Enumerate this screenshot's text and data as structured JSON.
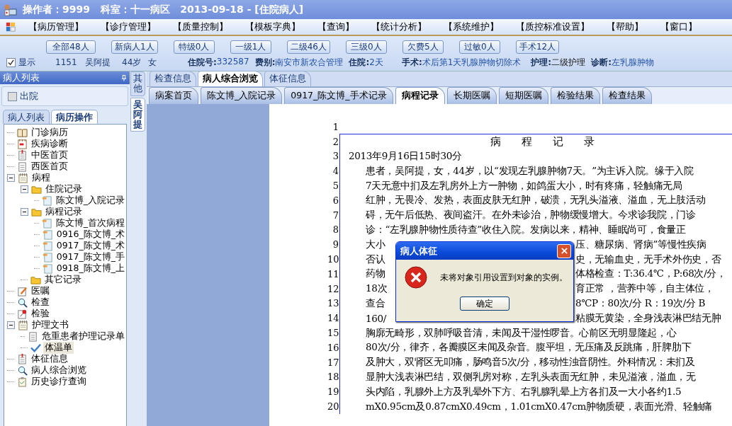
{
  "title_bar": {
    "text": "操作者：9999   科室：十一病区   2013-09-18 - [住院病人]"
  },
  "menu": [
    "【病历管理】",
    "【诊疗管理】",
    "【质量控制】",
    "【模板字典】",
    "【查询】",
    "【统计分析】",
    "【系统维护】",
    "【质控标准设置】",
    "【帮助】",
    "【窗口】"
  ],
  "filters": [
    "全部48人",
    "新病人1人",
    "特级0人",
    "一级1人",
    "二级46人",
    "三级0人",
    "欠费5人",
    "过敏0人",
    "手术12人"
  ],
  "patient": {
    "show": {
      "label": "显示",
      "checked": true
    },
    "bed": "1151",
    "name": "吴阿提",
    "age": "44岁",
    "sex": "女",
    "fields": [
      {
        "label": "住院号:",
        "value": "332587"
      },
      {
        "label": "费别:",
        "value": "南安市新农合管理"
      },
      {
        "label": "住院:",
        "value": "2天"
      },
      {
        "label": "手术:",
        "value": "术后第1天乳腺肿物切除术"
      },
      {
        "label": "护理:",
        "value": "二级护理"
      },
      {
        "label": "诊断:",
        "value": "左乳腺肿物"
      }
    ]
  },
  "left_panel": {
    "title": "病人列表",
    "discharged": {
      "label": "出院",
      "checked": false
    },
    "tabs": [
      {
        "label": "病人列表",
        "selected": false
      },
      {
        "label": "病历操作",
        "selected": true
      }
    ],
    "tree": [
      {
        "label": "门诊病历",
        "kind": "book",
        "selected": false
      },
      {
        "label": "疾病诊断",
        "kind": "calendar",
        "selected": false
      },
      {
        "label": "中医首页",
        "kind": "clip",
        "selected": false
      },
      {
        "label": "西医首页",
        "kind": "page",
        "selected": false
      },
      {
        "label": "病程",
        "kind": "notepad",
        "selected": false,
        "expanded": true,
        "children": [
          {
            "label": "住院记录",
            "kind": "folder",
            "selected": false,
            "expanded": true,
            "children": [
              {
                "label": "陈文博_入院记录",
                "kind": "file",
                "selected": false
              }
            ]
          },
          {
            "label": "病程记录",
            "kind": "folder",
            "selected": false,
            "expanded": true,
            "children": [
              {
                "label": "陈文博_首次病程",
                "kind": "file",
                "selected": false
              },
              {
                "label": "0916_陈文博_术",
                "kind": "file",
                "selected": false
              },
              {
                "label": "0917_陈文博_术",
                "kind": "file",
                "selected": false
              },
              {
                "label": "0917_陈文博_手",
                "kind": "file",
                "selected": false
              },
              {
                "label": "0918_陈文博_上",
                "kind": "file",
                "selected": false
              }
            ]
          },
          {
            "label": "其它记录",
            "kind": "folder",
            "selected": false
          }
        ]
      },
      {
        "label": "医嘱",
        "kind": "edit",
        "selected": false
      },
      {
        "label": "检查",
        "kind": "search",
        "selected": false
      },
      {
        "label": "检验",
        "kind": "pin",
        "selected": false
      },
      {
        "label": "护理文书",
        "kind": "notepad",
        "selected": false,
        "expanded": true,
        "children": [
          {
            "label": "危重患者护理记录单",
            "kind": "page",
            "selected": false
          },
          {
            "label": "体温单",
            "kind": "check",
            "selected": true
          }
        ]
      },
      {
        "label": "体征信息",
        "kind": "clip",
        "selected": false
      },
      {
        "label": "病人综合浏览",
        "kind": "search",
        "selected": false
      },
      {
        "label": "历史诊疗查询",
        "kind": "clipboard",
        "selected": false
      }
    ]
  },
  "side_tabs": [
    {
      "label": "其他",
      "selected": false
    },
    {
      "label": "吴阿提",
      "selected": true
    }
  ],
  "view_tabs": [
    {
      "label": "检查信息",
      "selected": false
    },
    {
      "label": "病人综合浏览",
      "selected": true
    },
    {
      "label": "体征信息",
      "selected": false
    }
  ],
  "doc_tabs": [
    {
      "label": "病案首页",
      "selected": false
    },
    {
      "label": "陈文博_入院记录",
      "selected": false
    },
    {
      "label": "0917_陈文博_手术记录",
      "selected": false
    },
    {
      "label": "病程记录",
      "selected": true
    },
    {
      "label": "长期医嘱",
      "selected": false
    },
    {
      "label": "短期医嘱",
      "selected": false
    },
    {
      "label": "检验结果",
      "selected": false
    },
    {
      "label": "检查结果",
      "selected": false
    }
  ],
  "document": {
    "lines": [
      {
        "no": "1",
        "kind": "blank"
      },
      {
        "no": "2",
        "kind": "title",
        "parts": [
          "病 程 记 录"
        ]
      },
      {
        "no": "3",
        "kind": "date",
        "parts": [
          "2013年9月16日15时30分"
        ]
      },
      {
        "no": "4",
        "kind": "body",
        "parts": [
          "患者，吴阿提，女，44岁，以“发现左乳腺肿物7天。”为主诉入院。缘于入院"
        ]
      },
      {
        "no": "5",
        "kind": "body",
        "parts": [
          "7天无意中扪及左乳房外上方一肿物，如鸽蛋大小，时有疼痛，轻触痛无局"
        ]
      },
      {
        "no": "6",
        "kind": "body",
        "parts": [
          "红肿，无畏冷、发热，表面皮肤无红肿，破溃，无乳头溢液、溢血，无上肢活动"
        ]
      },
      {
        "no": "7",
        "kind": "body",
        "parts": [
          "碍，无午后低热、夜间盗汗。在外未诊治，肿物缓慢增大。今求诊我院，门诊"
        ]
      },
      {
        "no": "8",
        "kind": "body",
        "parts": [
          "诊：“左乳腺肿物性质待查”收住入院。发病以来，精神、睡眠尚可，食量正"
        ]
      },
      {
        "no": "9",
        "kind": "body",
        "parts": [
          "大小",
          "压、糖尿病、肾病”等慢性疾病"
        ]
      },
      {
        "no": "10",
        "kind": "body",
        "parts": [
          "否认",
          "史，无输血史，无手术外伤史，否"
        ]
      },
      {
        "no": "11",
        "kind": "body",
        "parts": [
          "药物",
          "体格检查：T:36.4℃，P:68次/分，"
        ]
      },
      {
        "no": "12",
        "kind": "body",
        "parts": [
          "18次",
          "育正常 ，营养中等，自主体位，"
        ]
      },
      {
        "no": "13",
        "kind": "body",
        "parts": [
          "查合",
          "8℃P：80次/分  R：19次/分 B"
        ]
      },
      {
        "no": "14",
        "kind": "body",
        "parts": [
          "160/",
          "粘膜无黄染，全身浅表淋巴结无肿"
        ]
      },
      {
        "no": "15",
        "kind": "body",
        "parts": [
          "胸廓无畸形，双肺呼吸音清，未闻及干湿性啰音。心前区无明显隆起，心"
        ]
      },
      {
        "no": "16",
        "kind": "body",
        "parts": [
          "80次/分，律齐，各瓣膜区未闻及杂音。腹平坦，无压痛及反跳痛，肝脾肋下"
        ]
      },
      {
        "no": "17",
        "kind": "body",
        "parts": [
          "及肿大，双肾区无叩痛，肠鸣音5次/分，移动性浊音阴性。外科情况：未扪及"
        ]
      },
      {
        "no": "18",
        "kind": "body",
        "parts": [
          "显肿大浅表淋巴结，双侧乳房对称，左乳头表面无红肿，未见溢液，溢血，无"
        ]
      },
      {
        "no": "19",
        "kind": "body",
        "parts": [
          "头内陷，乳腺外上方及乳晕外下方、右乳腺乳晕上方各扪及一大小各约1.5"
        ]
      },
      {
        "no": "20",
        "kind": "body",
        "parts": [
          "mX0.95cm及0.87cmX0.49cm，1.01cmX0.47cm肿物质硬，表面光滑、轻触痛"
        ]
      }
    ]
  },
  "dialog": {
    "title": "病人体征",
    "message": "未将对象引用设置到对象的实例。",
    "button": "确定"
  }
}
